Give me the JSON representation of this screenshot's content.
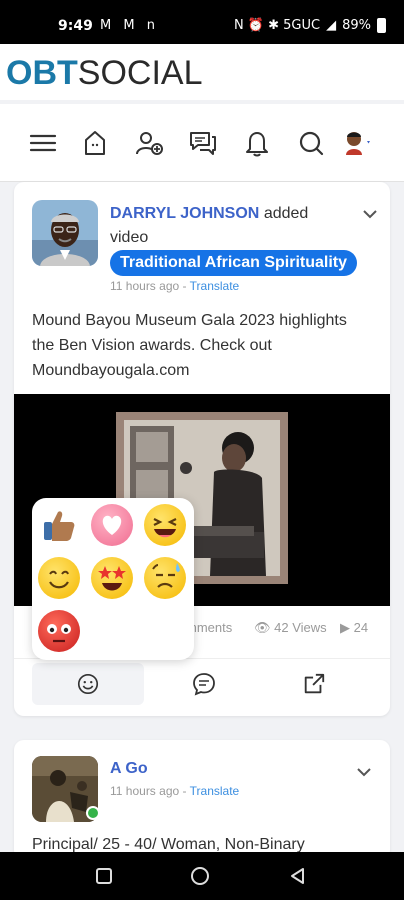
{
  "status": {
    "time": "9:49",
    "left_icons": "M M n",
    "right": "N ⏰ ✱ 5GUC",
    "battery": "89%"
  },
  "app": {
    "logo_obt": "OBT",
    "logo_social": "SOCIAL"
  },
  "nav": [
    "menu-icon",
    "home-icon",
    "add-friend-icon",
    "messages-icon",
    "notifications-icon",
    "search-icon",
    "profile-avatar"
  ],
  "post1": {
    "author": "DARRYL JOHNSON",
    "action_line1": "added",
    "action_line2": "video",
    "group": "Traditional African Spirituality",
    "time": "11 hours ago",
    "sep": "-",
    "translate": "Translate",
    "text": "Mound Bayou Museum Gala 2023 highlights the Ben Vision awards. Check out Moundbayougala.com",
    "comments": "mments",
    "views": "42 Views",
    "shares": "24"
  },
  "reactions": [
    "thumbs-up",
    "heart",
    "laughing",
    "smile",
    "star-struck",
    "sad",
    "angry"
  ],
  "post2": {
    "author": "A Go",
    "time": "11 hours ago",
    "sep": "-",
    "translate": "Translate",
    "text": "Principal/ 25 - 40/ Woman, Non-Binary"
  },
  "colors": {
    "brand": "#1b79a8",
    "accent": "#1673e6",
    "link": "#3d63c9"
  }
}
